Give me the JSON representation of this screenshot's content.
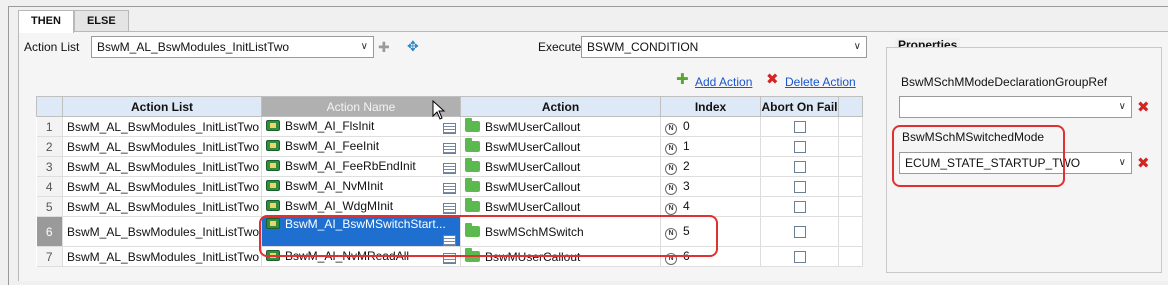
{
  "tabs": [
    "THEN",
    "ELSE"
  ],
  "action_list": {
    "label": "Action List",
    "value": "BswM_AL_BswModules_InitListTwo"
  },
  "execute": {
    "label": "Execute",
    "value": "BSWM_CONDITION"
  },
  "toolbar": {
    "add_action": "Add Action",
    "delete_action": "Delete Action"
  },
  "table": {
    "headers": [
      "Action List",
      "Action Name",
      "Action",
      "Index",
      "Abort On Fail"
    ],
    "rows": [
      {
        "num": "1",
        "list": "BswM_AL_BswModules_InitListTwo",
        "name": "BswM_AI_FlsInit",
        "action": "BswMUserCallout",
        "index": "0"
      },
      {
        "num": "2",
        "list": "BswM_AL_BswModules_InitListTwo",
        "name": "BswM_AI_FeeInit",
        "action": "BswMUserCallout",
        "index": "1"
      },
      {
        "num": "3",
        "list": "BswM_AL_BswModules_InitListTwo",
        "name": "BswM_AI_FeeRbEndInit",
        "action": "BswMUserCallout",
        "index": "2"
      },
      {
        "num": "4",
        "list": "BswM_AL_BswModules_InitListTwo",
        "name": "BswM_AI_NvMInit",
        "action": "BswMUserCallout",
        "index": "3"
      },
      {
        "num": "5",
        "list": "BswM_AL_BswModules_InitListTwo",
        "name": "BswM_AI_WdgMInit",
        "action": "BswMUserCallout",
        "index": "4"
      },
      {
        "num": "6",
        "list": "BswM_AL_BswModules_InitListTwo",
        "name": "BswM_AI_BswMSwitchStart...",
        "action": "BswMSchMSwitch",
        "index": "5"
      },
      {
        "num": "7",
        "list": "BswM_AL_BswModules_InitListTwo",
        "name": "BswM_AI_NvMReadAll",
        "action": "BswMUserCallout",
        "index": "6"
      }
    ],
    "selected_row": 6
  },
  "properties": {
    "title": "Properties",
    "mode_decl_label": "BswMSchMModeDeclarationGroupRef",
    "mode_decl_value": "",
    "switched_mode_label": "BswMSchMSwitchedMode",
    "switched_mode_value": "ECUM_STATE_STARTUP_TWO"
  },
  "colors": {
    "highlight": "#e0302f",
    "selection": "#1e6fd0",
    "link": "#1a55c9"
  }
}
